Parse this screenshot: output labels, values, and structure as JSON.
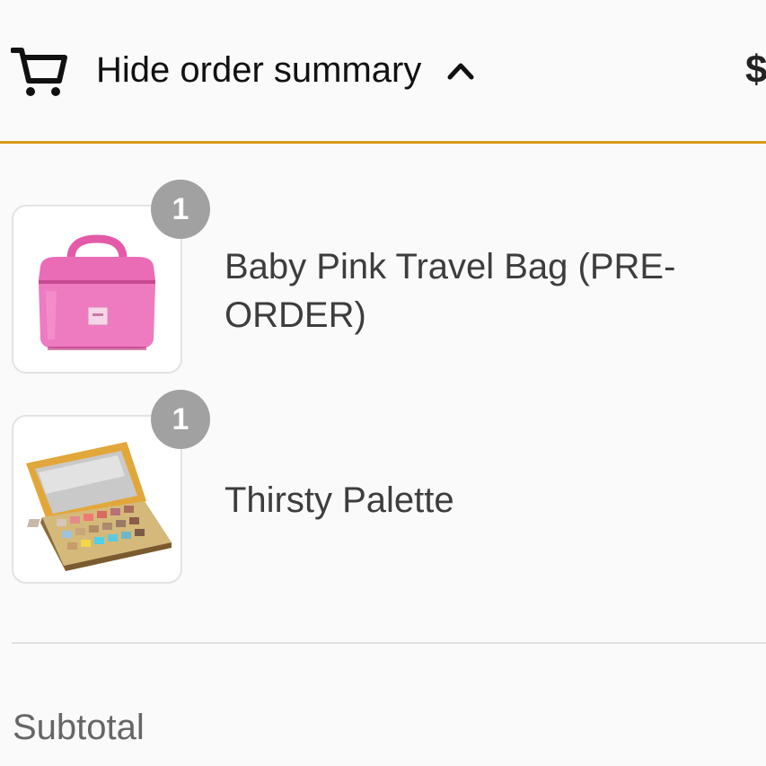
{
  "header": {
    "toggle_label": "Hide order summary",
    "total_price": "$"
  },
  "products": [
    {
      "name": "Baby Pink Travel Bag (PRE-ORDER)",
      "quantity": "1",
      "image": "pink-travel-bag"
    },
    {
      "name": "Thirsty Palette",
      "quantity": "1",
      "image": "eyeshadow-palette"
    }
  ],
  "summary": {
    "subtotal_label": "Subtotal"
  },
  "colors": {
    "accent_border": "#d79a1b",
    "badge": "#a1a1a1",
    "background": "#fafafa"
  }
}
